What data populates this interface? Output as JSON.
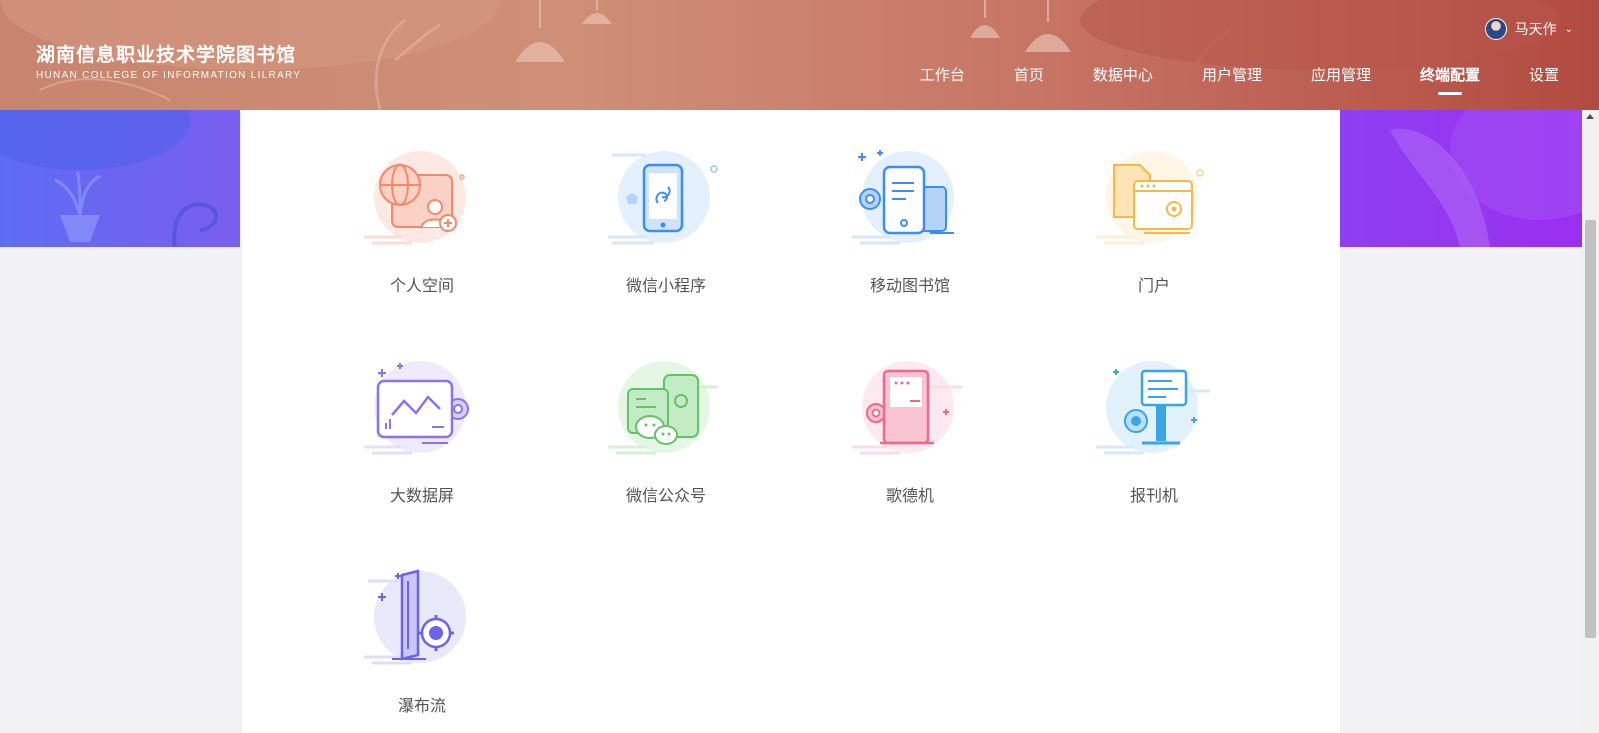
{
  "brand": {
    "title_cn": "湖南信息职业技术学院图书馆",
    "title_en": "HUNAN COLLEGE OF INFORMATION LILRARY"
  },
  "user": {
    "name": "马天作"
  },
  "nav": {
    "items": [
      {
        "label": "工作台"
      },
      {
        "label": "首页"
      },
      {
        "label": "数据中心"
      },
      {
        "label": "用户管理"
      },
      {
        "label": "应用管理"
      },
      {
        "label": "终端配置",
        "active": true
      },
      {
        "label": "设置"
      }
    ]
  },
  "tiles": [
    {
      "label": "个人空间",
      "icon": "personal-space-icon"
    },
    {
      "label": "微信小程序",
      "icon": "wechat-miniprogram-icon"
    },
    {
      "label": "移动图书馆",
      "icon": "mobile-library-icon"
    },
    {
      "label": "门户",
      "icon": "portal-icon"
    },
    {
      "label": "大数据屏",
      "icon": "bigdata-screen-icon"
    },
    {
      "label": "微信公众号",
      "icon": "wechat-official-icon"
    },
    {
      "label": "歌德机",
      "icon": "goethe-kiosk-icon"
    },
    {
      "label": "报刊机",
      "icon": "newspaper-kiosk-icon"
    },
    {
      "label": "瀑布流",
      "icon": "waterfall-icon"
    }
  ],
  "colors": {
    "header_start": "#c8846e",
    "header_end": "#b24a40",
    "band_left": "#5e6cf4",
    "band_right": "#9b2ff0"
  }
}
